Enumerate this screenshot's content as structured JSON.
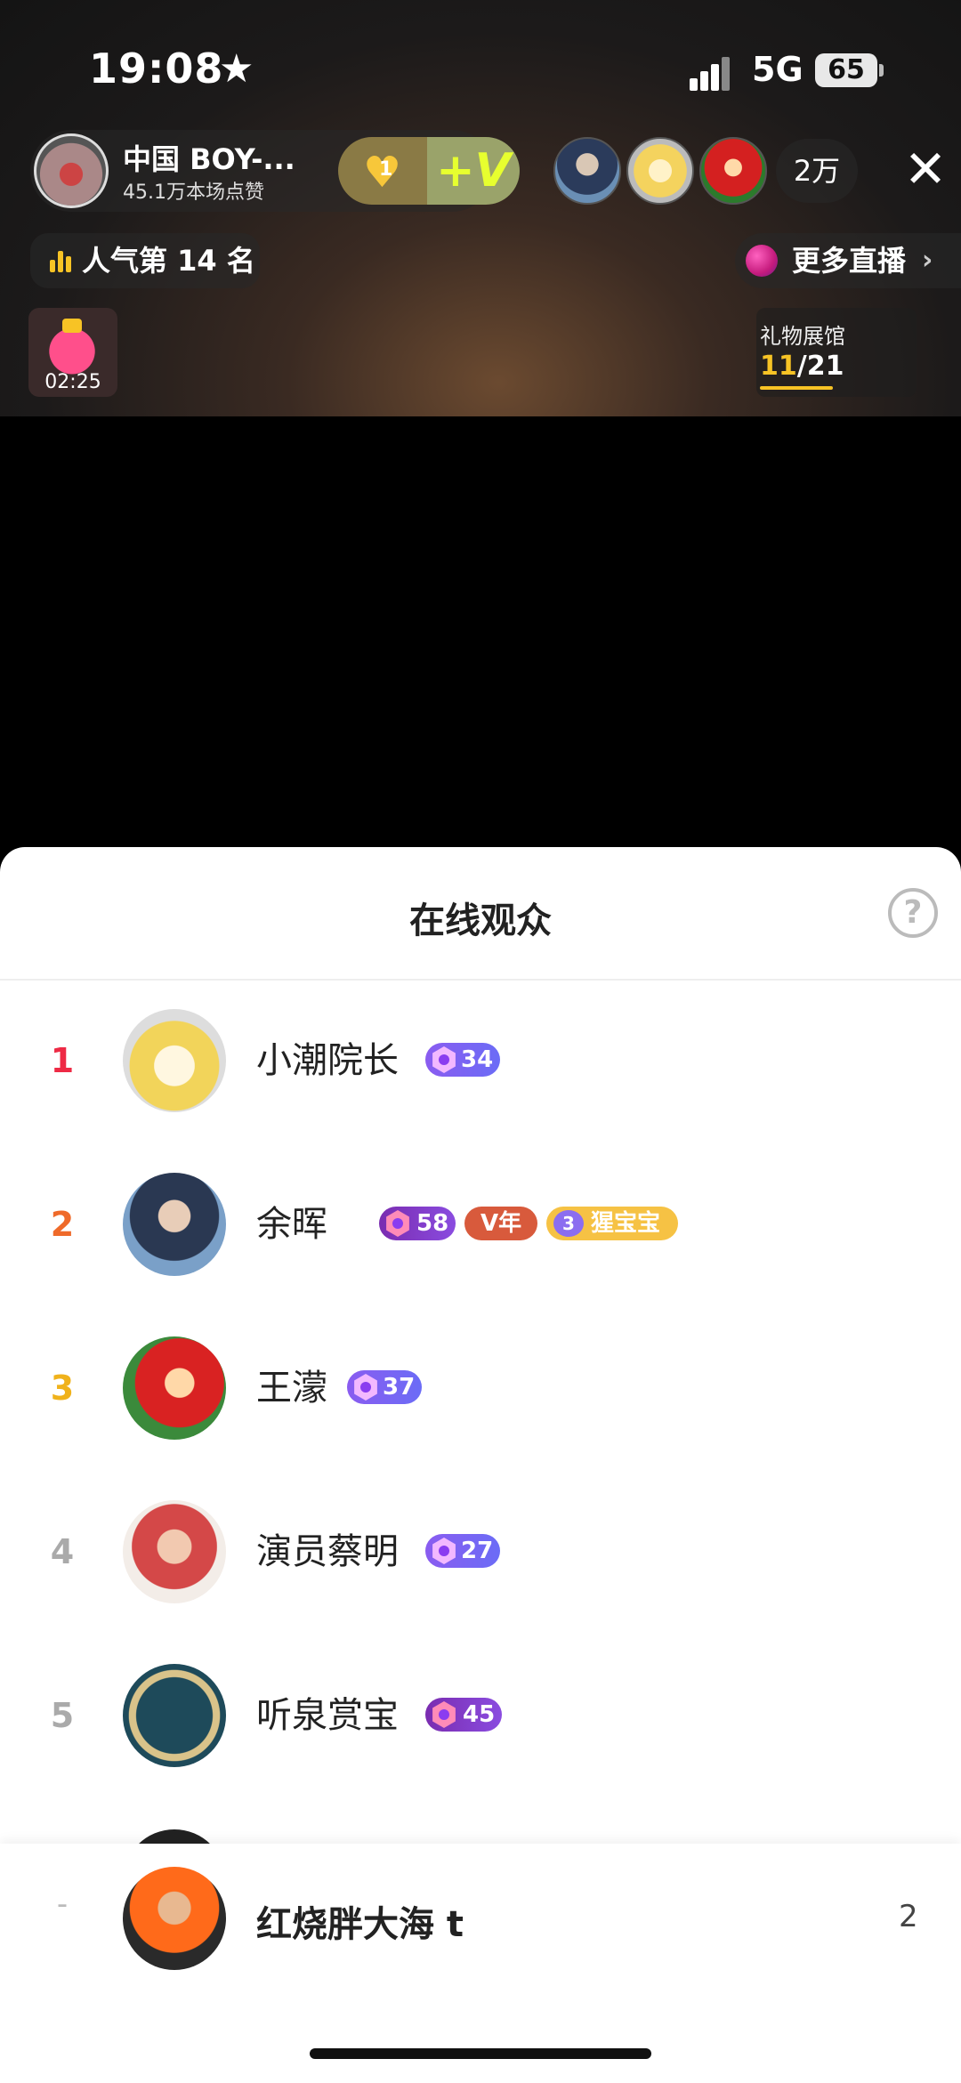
{
  "status_bar": {
    "time": "19:08",
    "network": "5G",
    "battery": "65"
  },
  "host": {
    "name": "中国 BOY-...",
    "likes": "45.1万本场点赞",
    "fan_level": "1"
  },
  "viewers_count": "2万",
  "popularity": "人气第 14 名",
  "more_live": "更多直播",
  "red_bag_timer": "02:25",
  "gift_hall": {
    "title": "礼物展馆",
    "current": "11",
    "total": "/21"
  },
  "sheet": {
    "title": "在线观众",
    "help": "?",
    "rows": [
      {
        "rank": "1",
        "name": "小潮院长",
        "level": "34"
      },
      {
        "rank": "2",
        "name": "余晖",
        "level": "58",
        "vyear": "V年",
        "baby_level": "3",
        "baby_text": "猩宝宝"
      },
      {
        "rank": "3",
        "name": "王濛",
        "level": "37"
      },
      {
        "rank": "4",
        "name": "演员蔡明",
        "level": "27"
      },
      {
        "rank": "5",
        "name": "听泉赏宝",
        "level": "45"
      }
    ],
    "self": {
      "rank": "-",
      "name": "红烧胖大海 t",
      "score": "2"
    }
  },
  "colors": {
    "rank1": "#ee2a45",
    "rank2": "#ef6a2a",
    "rank3": "#f0b21b",
    "accent_yellow": "#f7c325",
    "level_purple": "#8a5cf0"
  }
}
